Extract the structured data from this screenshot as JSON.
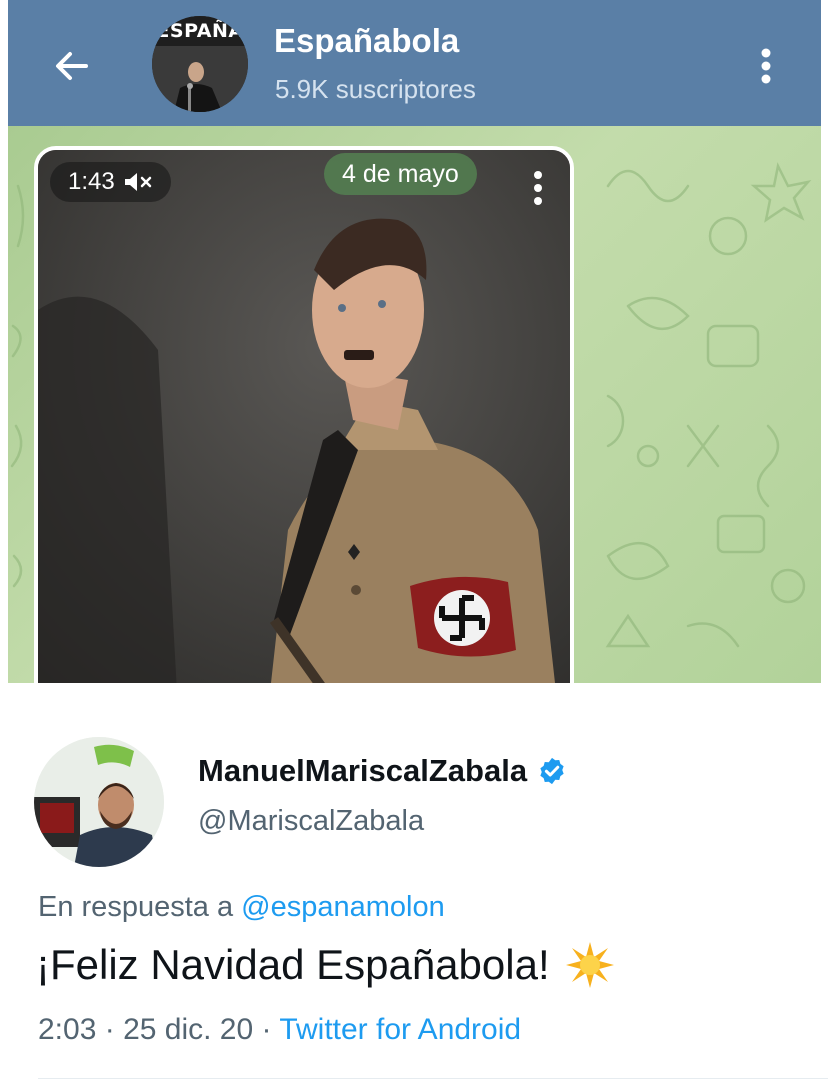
{
  "telegram": {
    "channel_name": "Españabola",
    "subscribers": "5.9K suscriptores",
    "avatar_text": "ESPAÑA",
    "video": {
      "duration": "1:43",
      "date": "4 de mayo",
      "muted_icon": "volume-muted-icon",
      "menu_icon": "vertical-dots-icon"
    },
    "icons": {
      "back": "back-arrow-icon",
      "menu": "vertical-dots-icon"
    },
    "colors": {
      "header": "#5a7fa6",
      "chat_background": "#b8d6a0",
      "date_chip": "#548252"
    }
  },
  "tweet": {
    "display_name": "ManuelMariscalZabala",
    "handle": "@MariscalZabala",
    "verified_icon": "verified-badge-icon",
    "reply_prefix": "En respuesta a",
    "reply_mention": "@espanamolon",
    "text": "¡Feliz Navidad Españabola!",
    "emoji": "🌟",
    "time": "2:03",
    "date": "25 dic. 20",
    "separator": "·",
    "source": "Twitter for Android",
    "colors": {
      "link": "#1d9bf0",
      "secondary_text": "#536471",
      "primary_text": "#0f1419"
    }
  }
}
